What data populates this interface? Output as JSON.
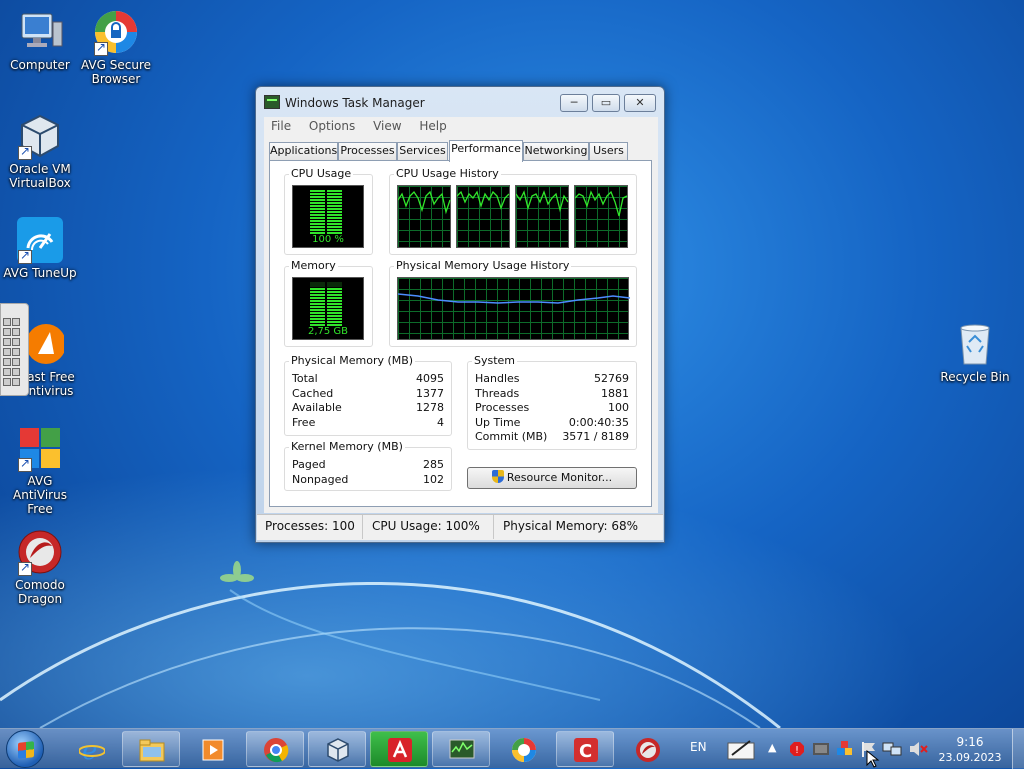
{
  "desktop": {
    "icons": [
      {
        "label1": "Computer",
        "label2": ""
      },
      {
        "label1": "AVG Secure",
        "label2": "Browser"
      },
      {
        "label1": "Oracle VM",
        "label2": "VirtualBox"
      },
      {
        "label1": "AVG TuneUp",
        "label2": ""
      },
      {
        "label1": "ast Free",
        "label2": "ntivirus"
      },
      {
        "label1": "AVG AntiVirus",
        "label2": "Free"
      },
      {
        "label1": "Comodo",
        "label2": "Dragon"
      },
      {
        "label1": "Recycle Bin",
        "label2": ""
      }
    ]
  },
  "window": {
    "title": "Windows Task Manager",
    "controls": {
      "minimize": "─",
      "maximize": "▭",
      "close": "✕"
    },
    "menu": [
      "File",
      "Options",
      "View",
      "Help"
    ],
    "tabs": [
      "Applications",
      "Processes",
      "Services",
      "Performance",
      "Networking",
      "Users"
    ],
    "active_tab": "Performance",
    "cpu_usage": {
      "label": "CPU Usage",
      "value": "100 %",
      "level": 1.0
    },
    "cpu_history": {
      "label": "CPU Usage History"
    },
    "memory": {
      "label": "Memory",
      "value": "2,75 GB",
      "level": 0.68
    },
    "memory_history": {
      "label": "Physical Memory Usage History"
    },
    "physical_memory": {
      "label": "Physical Memory (MB)",
      "rows": [
        {
          "k": "Total",
          "v": "4095"
        },
        {
          "k": "Cached",
          "v": "1377"
        },
        {
          "k": "Available",
          "v": "1278"
        },
        {
          "k": "Free",
          "v": "4"
        }
      ]
    },
    "kernel_memory": {
      "label": "Kernel Memory (MB)",
      "rows": [
        {
          "k": "Paged",
          "v": "285"
        },
        {
          "k": "Nonpaged",
          "v": "102"
        }
      ]
    },
    "system": {
      "label": "System",
      "rows": [
        {
          "k": "Handles",
          "v": "52769"
        },
        {
          "k": "Threads",
          "v": "1881"
        },
        {
          "k": "Processes",
          "v": "100"
        },
        {
          "k": "Up Time",
          "v": "0:00:40:35"
        },
        {
          "k": "Commit (MB)",
          "v": "3571 / 8189"
        }
      ]
    },
    "resource_monitor_button": "Resource Monitor...",
    "status": {
      "processes": "Processes: 100",
      "cpu": "CPU Usage: 100%",
      "memory": "Physical Memory: 68%"
    }
  },
  "taskbar": {
    "language": "EN",
    "time": "9:16",
    "date": "23.09.2023"
  }
}
